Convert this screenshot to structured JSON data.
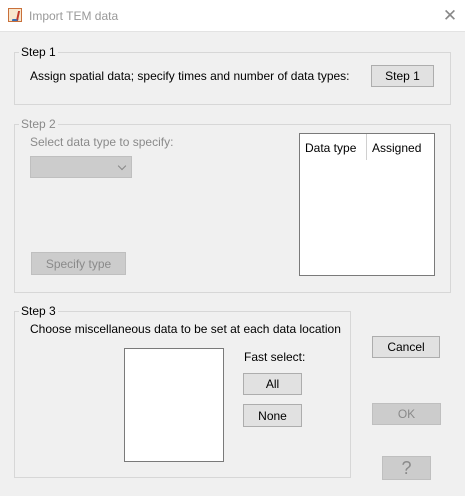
{
  "window": {
    "title": "Import TEM data",
    "app_icon": "java-icon",
    "close_icon": "close-icon"
  },
  "step1": {
    "legend": "Step 1",
    "description": "Assign spatial data; specify times and number of data types:",
    "button_label": "Step 1"
  },
  "step2": {
    "legend": "Step 2",
    "select_label": "Select data type to specify:",
    "dropdown_value": "",
    "specify_button_label": "Specify type",
    "table": {
      "columns": [
        "Data type",
        "Assigned"
      ],
      "rows": []
    }
  },
  "step3": {
    "legend": "Step 3",
    "description": "Choose miscellaneous data to be set at each data location",
    "fast_select_label": "Fast select:",
    "all_label": "All",
    "none_label": "None",
    "items": []
  },
  "actions": {
    "cancel_label": "Cancel",
    "ok_label": "OK",
    "help_label": "?"
  },
  "colors": {
    "background": "#f0f0f0",
    "disabled_text": "#8a8a8a",
    "button_face": "#e1e1e1",
    "disabled_face": "#cccccc"
  }
}
